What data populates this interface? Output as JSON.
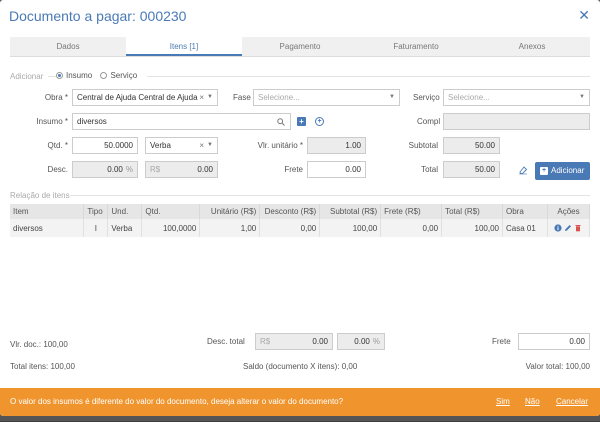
{
  "modal": {
    "title": "Documento a pagar: 000230",
    "close_icon": "close-icon"
  },
  "tabs": [
    {
      "label": "Dados",
      "active": false
    },
    {
      "label": "Itens [1]",
      "active": true
    },
    {
      "label": "Pagamento",
      "active": false
    },
    {
      "label": "Faturamento",
      "active": false
    },
    {
      "label": "Anexos",
      "active": false
    }
  ],
  "add_section": {
    "label": "Adicionar",
    "options": [
      "Insumo",
      "Serviço"
    ],
    "selected": "Insumo"
  },
  "form": {
    "obra_label": "Obra *",
    "obra_value": "Central de Ajuda Central de Ajuda",
    "fase_label": "Fase",
    "fase_placeholder": "Selecione...",
    "servico_label": "Serviço",
    "servico_placeholder": "Selecione...",
    "insumo_label": "Insumo *",
    "insumo_value": "diversos",
    "compl_label": "Compl",
    "compl_value": "",
    "qtd_label": "Qtd. *",
    "qtd_value": "50.0000",
    "unidade_value": "Verba",
    "vlr_unitario_label": "Vlr. unitário *",
    "vlr_unitario_value": "1.00",
    "subtotal_label": "Subtotal",
    "subtotal_value": "50.00",
    "desc_label": "Desc.",
    "desc_pct_value": "0.00",
    "desc_pct_suffix": "%",
    "desc_rs_prefix": "R$",
    "desc_rs_value": "0.00",
    "frete_label": "Frete",
    "frete_value": "0.00",
    "total_label": "Total",
    "total_value": "50.00",
    "add_button": "Adicionar"
  },
  "items_section": {
    "title": "Relação de itens",
    "columns": [
      "Item",
      "Tipo",
      "Und.",
      "Qtd.",
      "Unitário (R$)",
      "Desconto (R$)",
      "Subtotal (R$)",
      "Frete (R$)",
      "Total (R$)",
      "Obra",
      "Ações"
    ],
    "rows": [
      {
        "item": "diversos",
        "tipo": "I",
        "und": "Verba",
        "qtd": "100,0000",
        "unitario": "1,00",
        "desconto": "0,00",
        "subtotal": "100,00",
        "frete": "0,00",
        "total": "100,00",
        "obra": "Casa 01"
      }
    ]
  },
  "footer": {
    "vlr_doc": "Vlr. doc.: 100,00",
    "desc_total_label": "Desc. total",
    "desc_total_rs_prefix": "R$",
    "desc_total_rs_value": "0.00",
    "desc_total_pct_value": "0.00",
    "desc_total_pct_suffix": "%",
    "frete_label": "Frete",
    "frete_value": "0.00",
    "total_itens": "Total itens: 100,00",
    "saldo": "Saldo (documento X itens): 0,00",
    "valor_total": "Valor total: 100,00"
  },
  "warning": {
    "message": "O valor dos insumos é diferente do valor do documento, deseja alterar o valor do documento?",
    "yes": "Sim",
    "no": "Não",
    "cancel": "Cancelar",
    "color": "#f0952e"
  }
}
